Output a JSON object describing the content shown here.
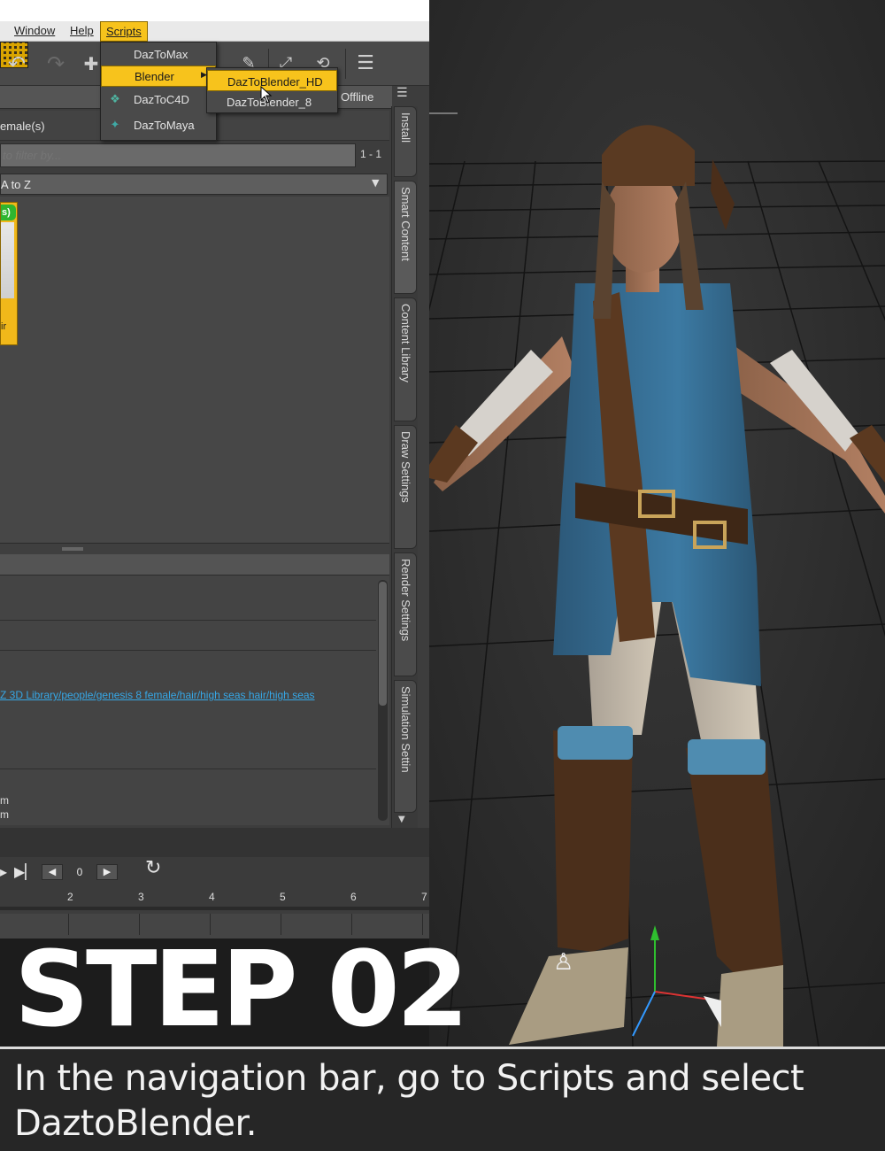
{
  "menubar": {
    "window": "Window",
    "help": "Help",
    "scripts": "Scripts"
  },
  "scripts_menu": {
    "items": [
      {
        "label": "DazToMax",
        "icon": "blank"
      },
      {
        "label": "Blender",
        "icon": "blank",
        "has_submenu": true
      },
      {
        "label": "DazToC4D",
        "icon": "c4d-icon"
      },
      {
        "label": "DazToMaya",
        "icon": "maya-icon"
      }
    ]
  },
  "blender_submenu": {
    "items": [
      {
        "label": "DazToBlender_HD"
      },
      {
        "label": "DazToBlender_8"
      }
    ]
  },
  "smart_content": {
    "offline": "Offline",
    "category": "emale(s)",
    "filter_placeholder": "to filter by...",
    "count": "1 - 1",
    "sort": "A to Z",
    "product_badge": "s)",
    "product_label": "ir"
  },
  "info": {
    "path": "Z 3D Library/people/genesis 8 female/hair/high seas hair/high seas",
    "trunc1": "m",
    "trunc2": "m"
  },
  "side_tabs": [
    "Install",
    "Smart Content",
    "Content Library",
    "Draw Settings",
    "Render Settings",
    "Simulation Settin"
  ],
  "timeline": {
    "frame": "0",
    "ticks": [
      "2",
      "3",
      "4",
      "5",
      "6",
      "7"
    ]
  },
  "caption": {
    "step": "STEP 02",
    "text": "In the navigation bar, go to Scripts and select DaztoBlender."
  },
  "colors": {
    "accent": "#f7c31c",
    "link": "#36a7e6",
    "badge": "#2fb52f"
  }
}
